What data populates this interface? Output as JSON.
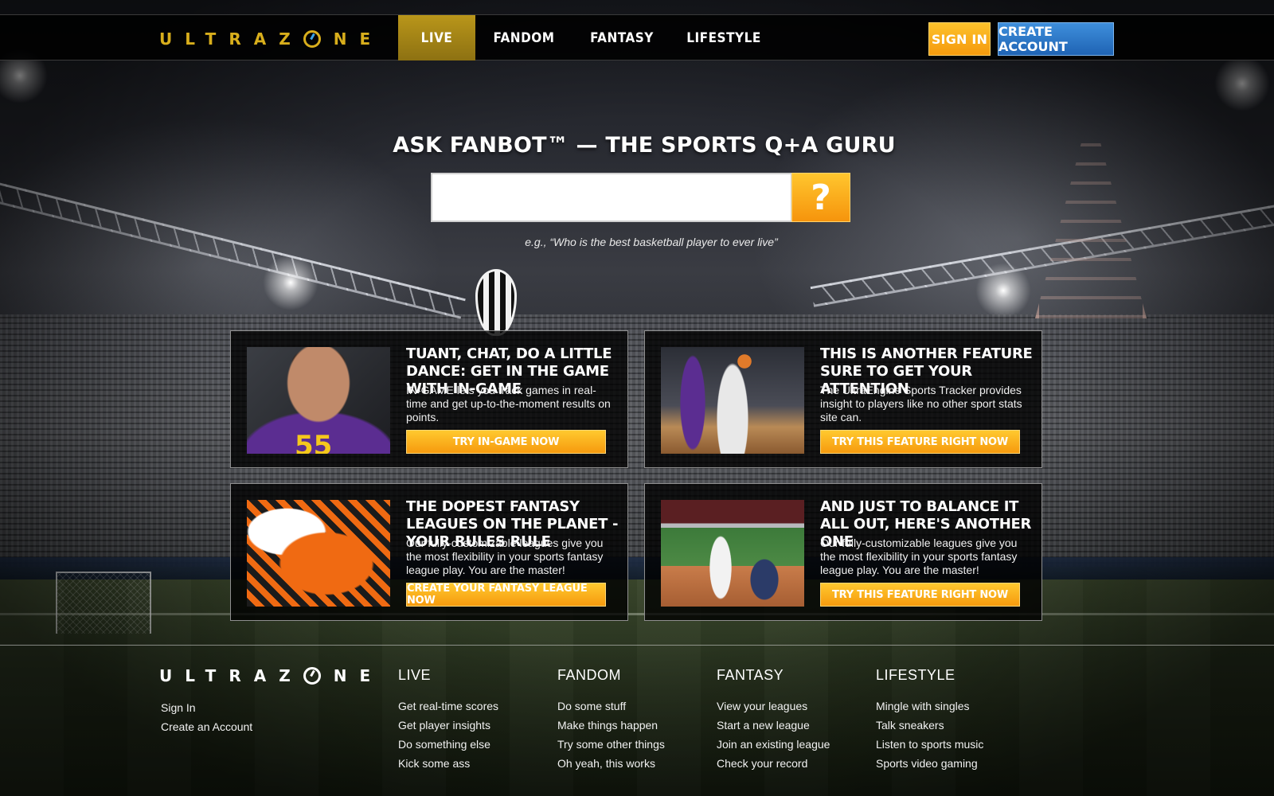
{
  "brand": {
    "name_prefix": "ULTRAZ",
    "name_suffix": "NE",
    "accent": "#d8ae1c"
  },
  "nav": {
    "items": [
      {
        "label": "LIVE",
        "active": true
      },
      {
        "label": "FANDOM",
        "active": false
      },
      {
        "label": "FANTASY",
        "active": false
      },
      {
        "label": "LIFESTYLE",
        "active": false
      }
    ],
    "signin_label": "SIGN IN",
    "create_label": "CREATE ACCOUNT"
  },
  "search": {
    "title": "ASK FANBOT™ — THE SPORTS Q+A GURU",
    "value": "",
    "button_glyph": "?",
    "hint": "e.g., “Who is the best basketball player to ever live”"
  },
  "cards": [
    {
      "title": "TUANT, CHAT, DO A LITTLE DANCE: GET IN THE GAME WITH IN-GAME",
      "text": "IN-GAME lets you track games in real-time and get up-to-the-moment results on points.",
      "button": "TRY IN-GAME NOW",
      "image_icon": "football-player-photo"
    },
    {
      "title": "THIS IS ANOTHER FEATURE SURE TO GET YOUR ATTENTION",
      "text": "The UltraEngine Sports Tracker provides insight to players like no other sport stats site can.",
      "button": "TRY THIS FEATURE RIGHT NOW",
      "image_icon": "basketball-photo"
    },
    {
      "title": "THE DOPEST FANTASY LEAGUES ON THE PLANET - YOUR RULES RULE",
      "text": "Our fully-customizable leagues give you the most flexibility in your sports fantasy league play. You are the master!",
      "button": "CREATE YOUR FANTASY LEAGUE NOW",
      "image_icon": "football-tackle-photo"
    },
    {
      "title": "AND JUST TO BALANCE IT ALL OUT, HERE'S ANOTHER ONE",
      "text": "Our fully-customizable leagues give you the most flexibility in your sports fantasy league play. You are the master!",
      "button": "TRY THIS FEATURE RIGHT NOW",
      "image_icon": "baseball-photo"
    }
  ],
  "footer": {
    "account_links": [
      "Sign In",
      "Create an Account"
    ],
    "columns": [
      {
        "heading": "LIVE",
        "links": [
          "Get real-time scores",
          "Get player insights",
          "Do something else",
          "Kick some ass"
        ]
      },
      {
        "heading": "FANDOM",
        "links": [
          "Do some stuff",
          "Make things happen",
          "Try some other things",
          "Oh yeah, this works"
        ]
      },
      {
        "heading": "FANTASY",
        "links": [
          "View your leagues",
          "Start a new league",
          "Join an existing league",
          "Check your record"
        ]
      },
      {
        "heading": "LIFESTYLE",
        "links": [
          "Mingle with singles",
          "Talk sneakers",
          "Listen to sports music",
          "Sports video gaming"
        ]
      }
    ]
  },
  "colors": {
    "cta_orange": "#f69a0e",
    "cta_blue": "#1f63b4",
    "nav_active": "#b9961a"
  }
}
